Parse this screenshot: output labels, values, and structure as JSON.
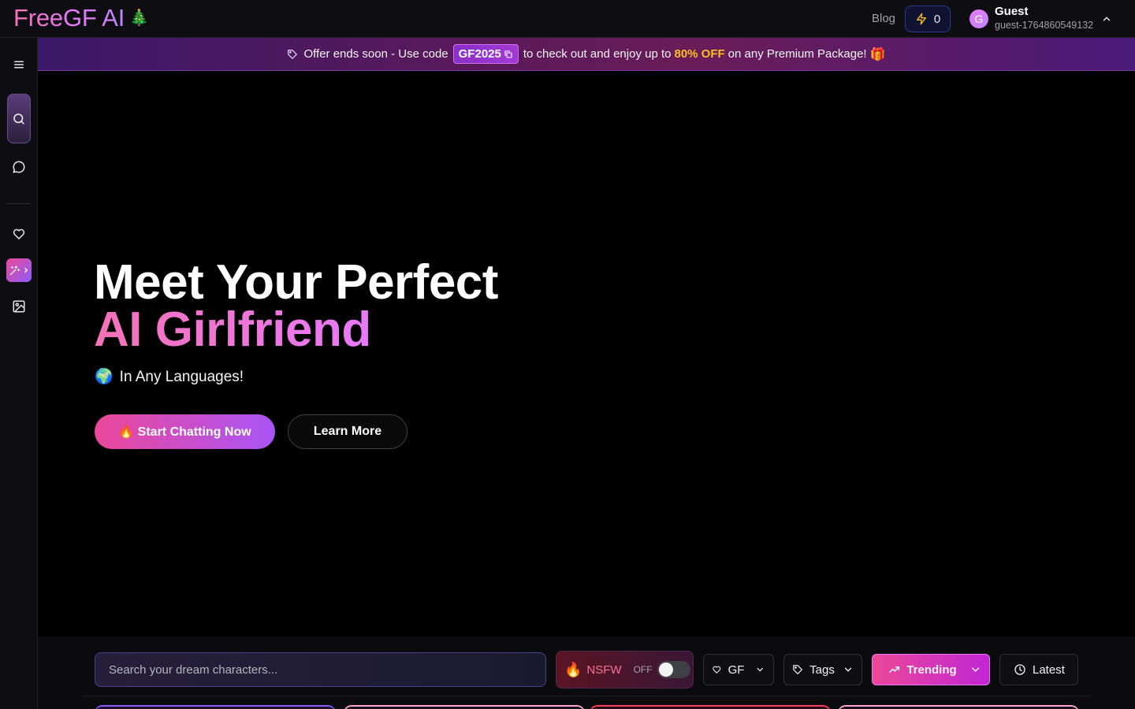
{
  "header": {
    "logo_text": "FreeGF AI",
    "logo_emoji": "🎄",
    "blog_label": "Blog",
    "credits_count": "0",
    "user": {
      "avatar_initial": "G",
      "name": "Guest",
      "id": "guest-1764860549132"
    }
  },
  "promo": {
    "text_before": "Offer ends soon - Use code",
    "code": "GF2025",
    "text_middle": "to check out and enjoy up to",
    "discount": "80% OFF",
    "text_after": "on any Premium Package!",
    "gift_emoji": "🎁"
  },
  "hero": {
    "title_line1": "Meet Your Perfect",
    "title_line2": "AI Girlfriend",
    "subtitle_emoji": "🌍",
    "subtitle": "In Any Languages!",
    "primary_button": "🔥 Start Chatting Now",
    "secondary_button": "Learn More"
  },
  "filters": {
    "search_placeholder": "Search your dream characters...",
    "nsfw_emoji": "🔥",
    "nsfw_label": "NSFW",
    "nsfw_state": "OFF",
    "nsfw_enabled": false,
    "gf_label": "GF",
    "tags_label": "Tags",
    "trending_label": "Trending",
    "latest_label": "Latest"
  },
  "sidebar": {
    "items": [
      "menu-icon",
      "search-icon",
      "chat-icon",
      "heart-icon",
      "magic-generate-icon",
      "image-icon"
    ]
  },
  "colors": {
    "accent_pink": "#ec4899",
    "accent_purple": "#a855f7",
    "promo_highlight": "#fbbf24",
    "nsfw_text": "#f87193"
  }
}
